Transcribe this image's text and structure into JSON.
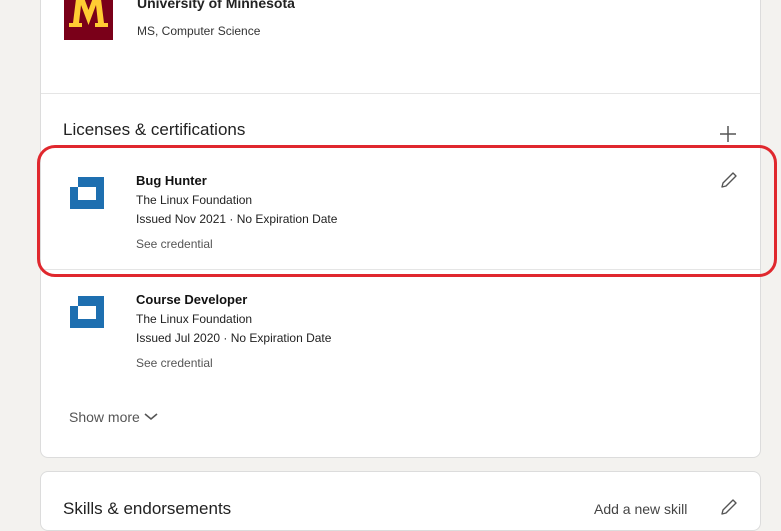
{
  "education": {
    "school": "University of Minnesota",
    "degree": "MS, Computer Science"
  },
  "licenses": {
    "title": "Licenses & certifications",
    "add_icon": "plus-icon",
    "items": [
      {
        "name": "Bug Hunter",
        "org": "The Linux Foundation",
        "issued": "Issued Nov 2021 · No Expiration Date",
        "link": "See credential",
        "edit_icon": "pencil-icon"
      },
      {
        "name": "Course Developer",
        "org": "The Linux Foundation",
        "issued": "Issued Jul 2020 · No Expiration Date",
        "link": "See credential"
      }
    ],
    "show_more": "Show more",
    "show_more_icon": "chevron-down-icon"
  },
  "skills": {
    "title": "Skills & endorsements",
    "add_label": "Add a new skill",
    "edit_icon": "pencil-icon"
  },
  "colors": {
    "highlight": "#e0282e",
    "umn_maroon": "#7a0019",
    "umn_gold": "#ffcc33",
    "linux_blue": "#1e6fb0"
  }
}
